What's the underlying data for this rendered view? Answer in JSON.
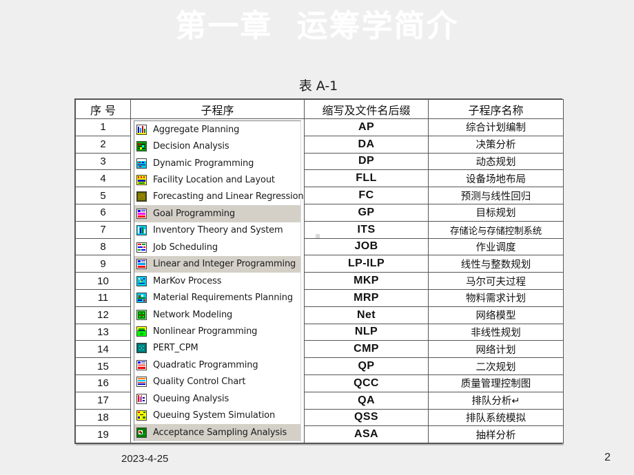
{
  "slide": {
    "background_color": "#efefef",
    "title": "第一章  运筹学简介",
    "title_color": "#ffffff"
  },
  "table": {
    "caption": "表 A-1",
    "headers": {
      "no": "序   号",
      "subprogram": "子程序",
      "abbr": "缩写及文件名后缀",
      "name": "子程序名称"
    },
    "rows": [
      {
        "no": "1",
        "subprogram": "Aggregate Planning",
        "abbr": "AP",
        "name": "综合计划编制",
        "selected": false
      },
      {
        "no": "2",
        "subprogram": "Decision Analysis",
        "abbr": "DA",
        "name": "决策分析",
        "selected": false
      },
      {
        "no": "3",
        "subprogram": "Dynamic Programming",
        "abbr": "DP",
        "name": "动态规划",
        "selected": false
      },
      {
        "no": "4",
        "subprogram": "Facility Location and Layout",
        "abbr": "FLL",
        "name": "设备场地布局",
        "selected": false
      },
      {
        "no": "5",
        "subprogram": "Forecasting and Linear Regression",
        "abbr": "FC",
        "name": "预测与线性回归",
        "selected": false
      },
      {
        "no": "6",
        "subprogram": "Goal Programming",
        "abbr": "GP",
        "name": "目标规划",
        "selected": true
      },
      {
        "no": "7",
        "subprogram": "Inventory Theory and System",
        "abbr": "ITS",
        "name": "存储论与存储控制系统",
        "selected": false
      },
      {
        "no": "8",
        "subprogram": "Job Scheduling",
        "abbr": "JOB",
        "name": "作业调度",
        "selected": false
      },
      {
        "no": "9",
        "subprogram": "Linear and Integer Programming",
        "abbr": "LP-ILP",
        "name": "线性与整数规划",
        "selected": true
      },
      {
        "no": "10",
        "subprogram": "MarKov Process",
        "abbr": "MKP",
        "name": "马尔可夫过程",
        "selected": false
      },
      {
        "no": "11",
        "subprogram": "Material Requirements Planning",
        "abbr": "MRP",
        "name": "物料需求计划",
        "selected": false
      },
      {
        "no": "12",
        "subprogram": "Network Modeling",
        "abbr": "Net",
        "name": "网络模型",
        "selected": false
      },
      {
        "no": "13",
        "subprogram": "Nonlinear Programming",
        "abbr": "NLP",
        "name": "非线性规划",
        "selected": false
      },
      {
        "no": "14",
        "subprogram": "PERT_CPM",
        "abbr": "CMP",
        "name": "网络计划",
        "selected": false
      },
      {
        "no": "15",
        "subprogram": "Quadratic Programming",
        "abbr": "QP",
        "name": "二次规划",
        "selected": false
      },
      {
        "no": "16",
        "subprogram": "Quality Control Chart",
        "abbr": "QCC",
        "name": "质量管理控制图",
        "selected": false
      },
      {
        "no": "17",
        "subprogram": "Queuing Analysis",
        "abbr": "QA",
        "name": "排队分析↵",
        "selected": false
      },
      {
        "no": "18",
        "subprogram": "Queuing System Simulation",
        "abbr": "QSS",
        "name": "排队系统模拟",
        "selected": false
      },
      {
        "no": "19",
        "subprogram": "Acceptance Sampling Analysis",
        "abbr": "ASA",
        "name": "抽样分析",
        "selected": true
      }
    ],
    "icons": [
      "aggregate-planning-icon",
      "decision-analysis-icon",
      "dynamic-programming-icon",
      "facility-location-icon",
      "forecasting-regression-icon",
      "goal-programming-icon",
      "inventory-theory-icon",
      "job-scheduling-icon",
      "linear-integer-programming-icon",
      "markov-process-icon",
      "material-requirements-icon",
      "network-modeling-icon",
      "nonlinear-programming-icon",
      "pert-cpm-icon",
      "quadratic-programming-icon",
      "quality-control-chart-icon",
      "queuing-analysis-icon",
      "queuing-simulation-icon",
      "acceptance-sampling-icon"
    ],
    "selected_row_color": "#d4d0c8"
  },
  "footer": {
    "date": "2023-4-25",
    "page_number": "2"
  }
}
